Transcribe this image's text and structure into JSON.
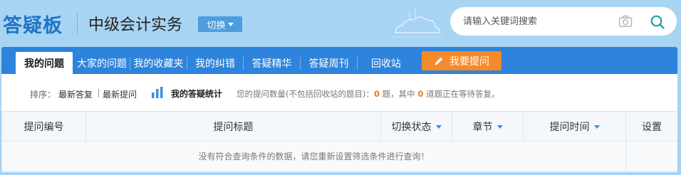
{
  "header": {
    "brand": "答疑板",
    "subject": "中级会计实务",
    "switch_label": "切换"
  },
  "search": {
    "placeholder": "请输入关键词搜索",
    "value": "",
    "camera_icon": "camera-icon",
    "search_icon": "search-icon"
  },
  "tabs": [
    {
      "label": "我的问题",
      "active": true
    },
    {
      "label": "大家的问题",
      "active": false
    },
    {
      "label": "我的收藏夹",
      "active": false
    },
    {
      "label": "我的纠错",
      "active": false
    },
    {
      "label": "答疑精华",
      "active": false
    },
    {
      "label": "答疑周刊",
      "active": false
    },
    {
      "label": "回收站",
      "active": false
    }
  ],
  "ask_button": {
    "label": "我要提问",
    "icon": "pencil-icon"
  },
  "filter": {
    "sort_label": "排序：",
    "sort_options": [
      "最新答复",
      "最新提问"
    ],
    "stats_title": "我的答疑统计",
    "stats_prefix": "您的提问数量(不包括回收站的题目)：",
    "question_count": "0",
    "stats_middle": "题，其中",
    "pending_count": "0",
    "stats_suffix": "道题正在等待答复。"
  },
  "table": {
    "columns": [
      "提问编号",
      "提问标题",
      "切换状态",
      "章节",
      "提问时间",
      "设置"
    ],
    "empty_message": "没有符合查询条件的数据，请您重新设置筛选条件进行查询！"
  },
  "colors": {
    "brand": "#1f74c8",
    "tabbar": "#2e83da",
    "ask_button": "#f58a2a",
    "count_highlight": "#f07d18",
    "background": "#a9d4f3"
  }
}
